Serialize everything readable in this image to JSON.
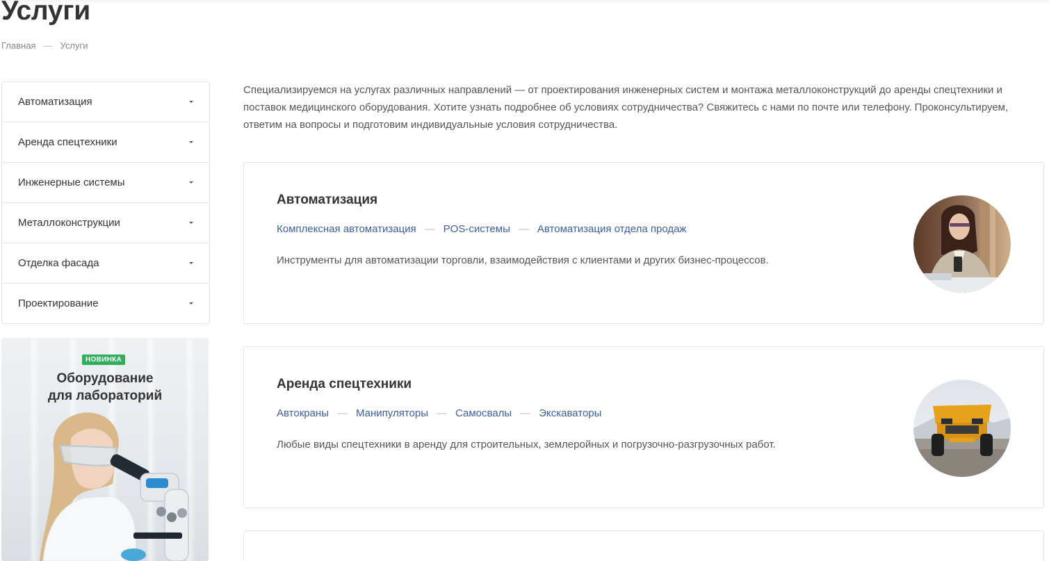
{
  "page": {
    "title": "Услуги"
  },
  "breadcrumb": {
    "items": [
      "Главная",
      "Услуги"
    ],
    "separator": "—"
  },
  "sidebar": {
    "items": [
      {
        "label": "Автоматизация"
      },
      {
        "label": "Аренда спецтехники"
      },
      {
        "label": "Инженерные системы"
      },
      {
        "label": "Металлоконструкции"
      },
      {
        "label": "Отделка фасада"
      },
      {
        "label": "Проектирование"
      }
    ]
  },
  "banner": {
    "badge": "НОВИНКА",
    "title_line1": "Оборудование",
    "title_line2": "для лабораторий",
    "badge_color": "#2fae5d"
  },
  "intro": {
    "text": "Специализируемся на услугах различных направлений — от проектирования инженерных систем и монтажа металлоконструкций до аренды спецтехники и поставок медицинского оборудования. Хотите узнать подробнее об условиях сотрудничества? Свяжитесь с нами по почте или телефону. Проконсультируем, ответим на вопросы и подготовим индивидуальные условия сотрудничества."
  },
  "services": [
    {
      "title": "Автоматизация",
      "links": [
        "Комплексная автоматизация",
        "POS-системы",
        "Автоматизация отдела продаж"
      ],
      "description": "Инструменты для автоматизации торговли, взаимодействия с клиентами и других бизнес-процессов.",
      "image_icon": "woman-with-coffee-photo"
    },
    {
      "title": "Аренда спецтехники",
      "links": [
        "Автокраны",
        "Манипуляторы",
        "Самосвалы",
        "Экскаваторы"
      ],
      "description": "Любые виды спецтехники в аренду для строительных, землеройных и погрузочно-разгрузочных работ.",
      "image_icon": "dump-truck-photo"
    }
  ],
  "colors": {
    "link": "#3b5f9f",
    "text": "#333333",
    "muted": "#555555",
    "border": "#e5e5e5"
  }
}
